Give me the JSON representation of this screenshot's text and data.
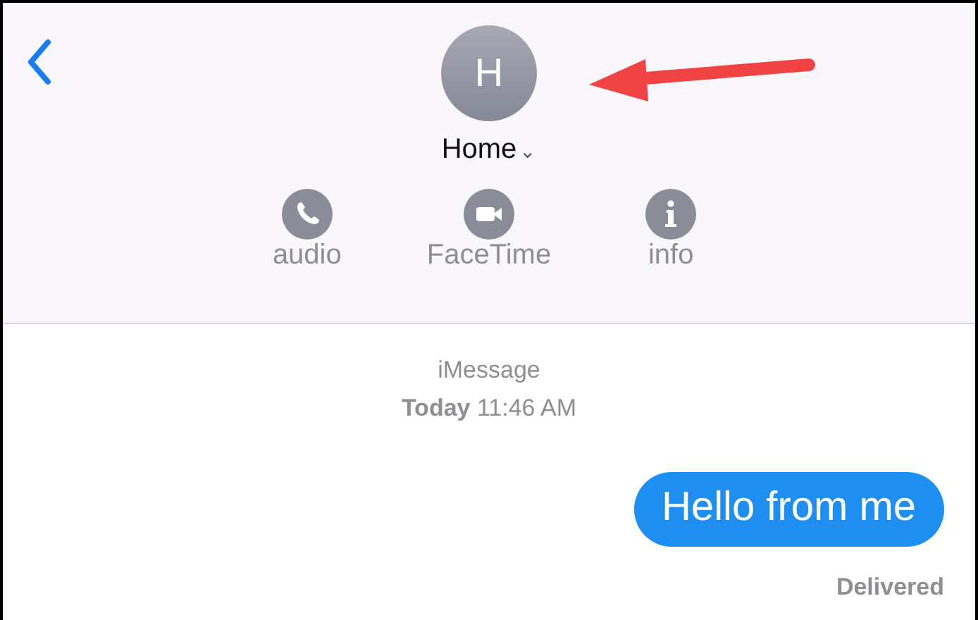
{
  "header": {
    "avatar_initial": "H",
    "contact_name": "Home",
    "dropdown": "⌄",
    "actions": [
      {
        "kind": "phone",
        "label": "audio"
      },
      {
        "kind": "video",
        "label": "FaceTime"
      },
      {
        "kind": "info",
        "label": "info"
      }
    ]
  },
  "conversation": {
    "service": "iMessage",
    "timestamp": "**Today** 11:46 AM",
    "messages": [
      {
        "text": "Hello from me",
        "status": "Delivered"
      }
    ]
  }
}
